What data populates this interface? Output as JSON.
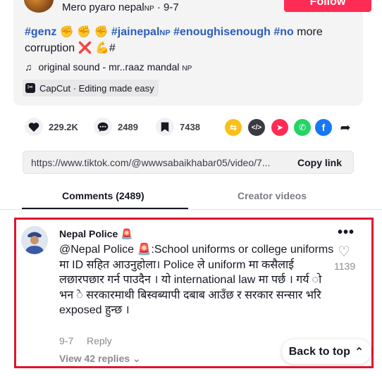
{
  "post": {
    "author": "Mero pyaro nepal",
    "author_suffix": "NP",
    "date": "· 9-7",
    "follow_label": "Follow",
    "caption_tag1": "#genz",
    "caption_e1": "✊ ✊ ✊",
    "caption_tag2": "#jainepal",
    "caption_np": "NP",
    "caption_tag3": "#enoughisenough",
    "caption_tag4": "#no",
    "caption_more": "more",
    "caption_line2": "corruption",
    "caption_e2": "❌ 💪",
    "caption_hash": "#",
    "sound_icon": "music-note-icon",
    "sound": "original sound - mr..raaz mandal",
    "sound_suffix": "NP",
    "capcut_label": "CapCut · Editing made easy"
  },
  "actions": {
    "likes": "229.2K",
    "comments": "2489",
    "saves": "7438"
  },
  "share": {
    "url": "https://www.tiktok.com/@wwwsabaikhabar05/video/7...",
    "copy_label": "Copy link"
  },
  "tabs": {
    "comments": "Comments (2489)",
    "creator": "Creator videos"
  },
  "comment": {
    "user": "Nepal Police",
    "text": "@Nepal Police 🚨:School uniforms or college uniforms मा ID सहित आउनुहोला। Police ले uniform मा कसैलाई लछारपछार गर्न पाउदैन । यो international law मा पर्छ । गर्य ो भन े सरकारमाथी बिस्वब्यापी दबाब आउँछ र सरकार सन्सार भरि exposed हुन्छ ।",
    "likes": "1139",
    "date": "9-7",
    "reply_label": "Reply",
    "view_replies": "View 42 replies",
    "more_icon": "ellipsis-icon",
    "like_icon": "heart-outline-icon"
  },
  "back_to_top": {
    "label": "Back to top",
    "icon": "double-chevron-up-icon"
  },
  "colors": {
    "follow": "#fe2c55",
    "hashtag": "#2b5db9",
    "highlight_border": "#e0142f"
  }
}
